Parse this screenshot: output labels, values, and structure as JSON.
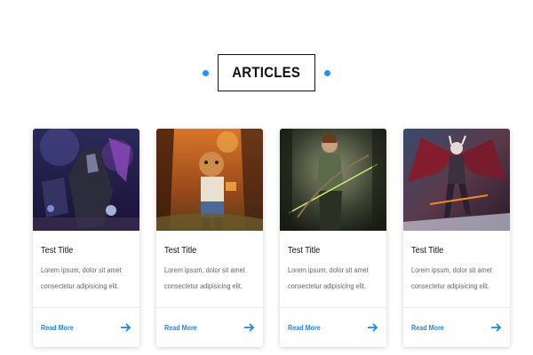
{
  "section": {
    "title": "ARTICLES",
    "accent_color": "#2196f3"
  },
  "cards": [
    {
      "image": "dark-warrior-art",
      "title": "Test Title",
      "text_line1": "Lorem ipsum, dolor sit amet",
      "text_line2": "consectetur adipisicing elit.",
      "link_label": "Read More",
      "link_icon": "arrow-right-icon"
    },
    {
      "image": "forest-character-art",
      "title": "Test Title",
      "text_line1": "Lorem ipsum, dolor sit amet",
      "text_line2": "consectetur adipisicing elit.",
      "link_label": "Read More",
      "link_icon": "arrow-right-icon"
    },
    {
      "image": "archer-woman-art",
      "title": "Test Title",
      "text_line1": "Lorem ipsum, dolor sit amet",
      "text_line2": "consectetur adipisicing elit.",
      "link_label": "Read More",
      "link_icon": "arrow-right-icon"
    },
    {
      "image": "winged-demon-art",
      "title": "Test Title",
      "text_line1": "Lorem ipsum, dolor sit amet",
      "text_line2": "consectetur adipisicing elit.",
      "link_label": "Read More",
      "link_icon": "arrow-right-icon"
    }
  ]
}
